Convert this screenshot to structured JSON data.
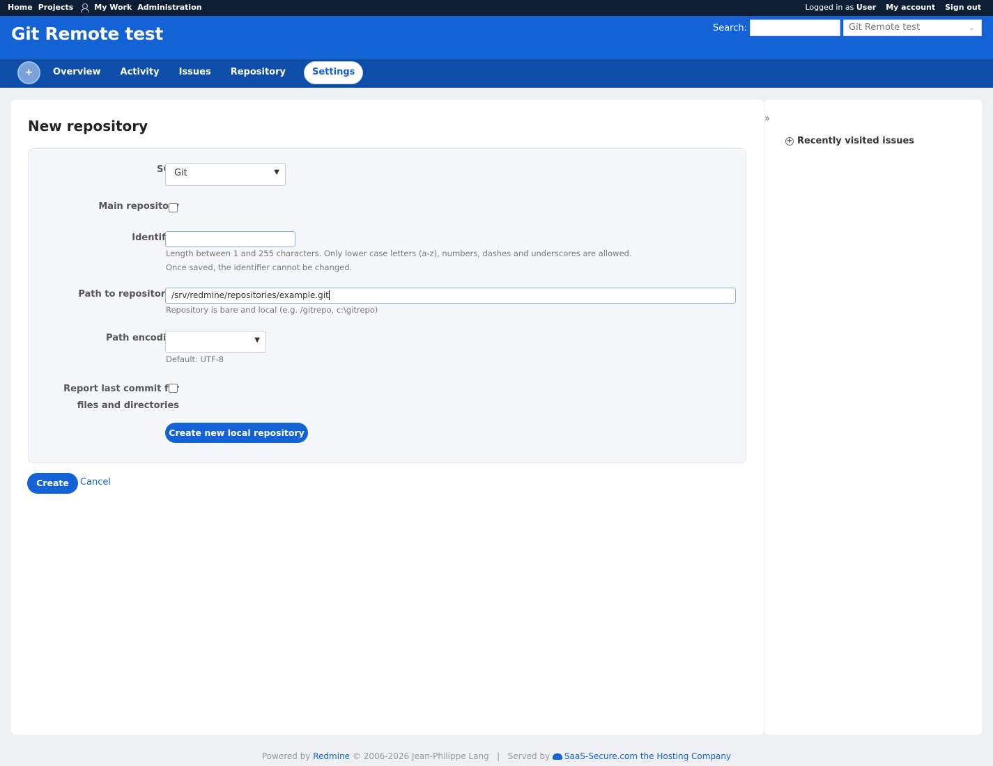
{
  "top_menu": {
    "items": [
      "Home",
      "Projects",
      "My Work",
      "Administration"
    ],
    "logged_in_prefix": "Logged in as",
    "user": "User",
    "my_account": "My account",
    "sign_out": "Sign out"
  },
  "header": {
    "title": "Git Remote test",
    "search_label": "Search:",
    "search_value": "",
    "project_jump": "Git Remote test"
  },
  "main_menu": {
    "new_object": "+",
    "tabs": [
      "Overview",
      "Activity",
      "Issues",
      "Repository",
      "Settings"
    ],
    "selected": "Settings"
  },
  "form": {
    "title": "New repository",
    "scm_label": "SCM",
    "scm_value": "Git",
    "main_repo_label": "Main repository",
    "main_repo_checked": false,
    "identifier_label": "Identifier",
    "identifier_value": "",
    "identifier_hint_1": "Length between 1 and 255 characters. Only lower case letters (a-z), numbers, dashes and underscores are allowed.",
    "identifier_hint_2": "Once saved, the identifier cannot be changed.",
    "path_label": "Path to repository *",
    "path_value": "/srv/redmine/repositories/example.git",
    "path_hint": "Repository is bare and local (e.g. /gitrepo, c:\\gitrepo)",
    "encoding_label": "Path encoding",
    "encoding_value": "",
    "encoding_hint": "Default: UTF-8",
    "report_label_1": "Report last commit for",
    "report_label_2": "files and directories",
    "report_checked": false,
    "create_local_button": "Create new local repository",
    "create_button": "Create",
    "cancel_link": "Cancel"
  },
  "sidebar": {
    "toggle": "»",
    "recent_icon": "+",
    "recent_title": "Recently visited issues"
  },
  "footer": {
    "powered_by": "Powered by",
    "redmine": "Redmine",
    "copyright": "© 2006-2026 Jean-Philippe Lang",
    "separator": "|",
    "served_by": "Served by",
    "host": "SaaS-Secure.com the Hosting Company"
  }
}
